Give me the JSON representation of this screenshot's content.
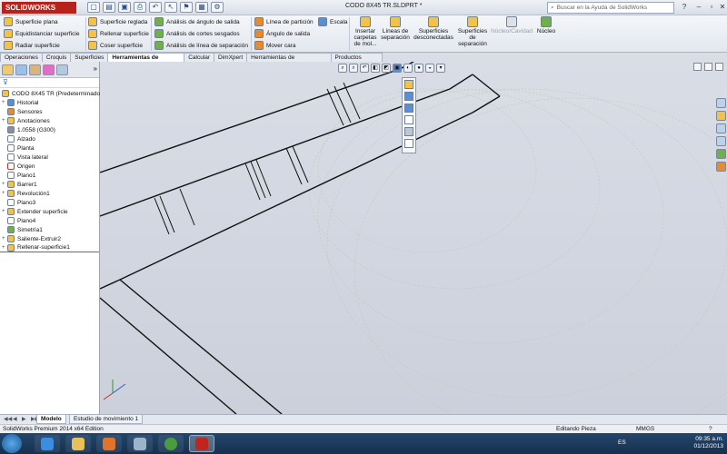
{
  "app": {
    "brand": "SOLIDWORKS",
    "document_title": "CODO 8X45 TR.SLDPRT *"
  },
  "search": {
    "placeholder": "Buscar en la Ayuda de SolidWorks"
  },
  "ribbon": {
    "col1": [
      "Superficie plana",
      "Equidistanciar superficie",
      "Radiar superficie"
    ],
    "col2": [
      "Superficie reglada",
      "Rellenar superficie",
      "Coser superficie"
    ],
    "col3": [
      "Análisis de ángulo de salida",
      "Análisis de cortes sesgados",
      "Análisis de línea de separación"
    ],
    "col4": [
      "Línea de partición",
      "Ángulo de salida",
      "Mover cara"
    ],
    "col5": [
      "Escala"
    ],
    "big": [
      "Insertar carpetas de mol...",
      "Líneas de separación",
      "Superficies desconectadas",
      "Superficies de separación",
      "Núcleo/Cavidad",
      "Núcleo"
    ]
  },
  "tabs": [
    "Operaciones",
    "Croquis",
    "Superficies",
    "Herramientas de moldes",
    "Calcular",
    "DimXpert",
    "Herramientas de renderizado",
    "Productos Office"
  ],
  "active_tab": "Herramientas de moldes",
  "tree": {
    "root": "CODO 8X45 TR  (Predeterminado<",
    "items": [
      "Historial",
      "Sensores",
      "Anotaciones",
      "1.0558 (G300)",
      "Alzado",
      "Planta",
      "Vista lateral",
      "Origen",
      "Plano1",
      "Barrer1",
      "Revolución1",
      "Plano3",
      "Extender superficie",
      "Plano4",
      "Simetría1",
      "Saliente-Extruir2",
      "Rellenar-superficie1"
    ]
  },
  "bottom_tabs": [
    "Modelo",
    "Estudio de movimiento 1"
  ],
  "status": {
    "edition": "SolidWorks Premium 2014 x64 Edition",
    "mode": "Editando Pieza",
    "units": "MMGS"
  },
  "taskbar": {
    "lang": "ES",
    "time": "09:35 a.m.",
    "date": "01/12/2013"
  }
}
